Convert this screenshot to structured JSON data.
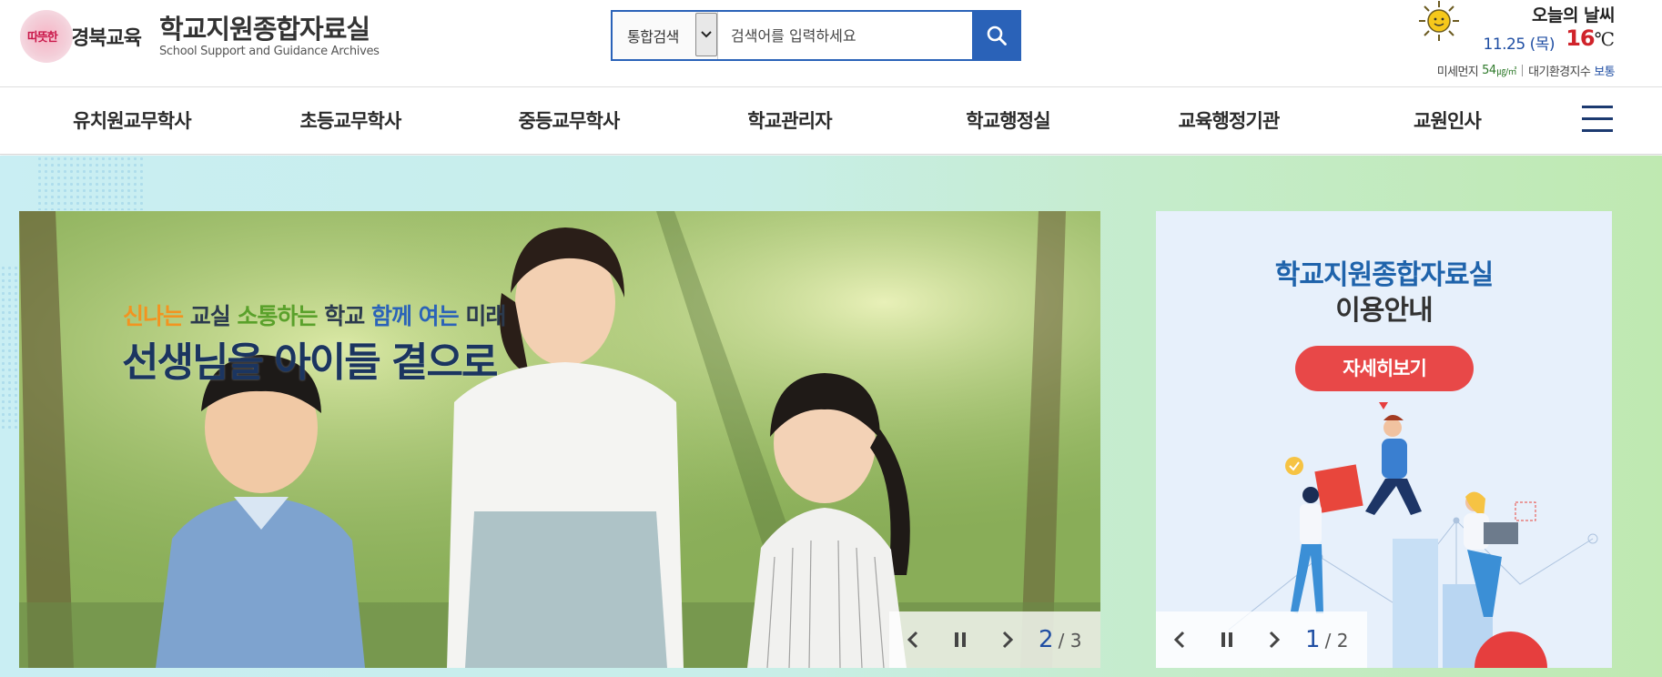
{
  "header": {
    "logo_seal_text": "따뜻한",
    "logo_brand": "경북교육",
    "site_title": "학교지원종합자료실",
    "site_subtitle": "School Support and Guidance Archives"
  },
  "search": {
    "scope_label": "통합검색",
    "placeholder": "검색어를 입력하세요"
  },
  "weather": {
    "title": "오늘의 날씨",
    "date": "11.25 (목)",
    "temperature": "16",
    "temperature_unit": "℃",
    "fine_dust_label": "미세먼지",
    "fine_dust_value": "54",
    "fine_dust_unit": "㎍/㎥",
    "air_index_label": "대기환경지수",
    "air_index_value": "보통"
  },
  "nav": {
    "items": [
      "유치원교무학사",
      "초등교무학사",
      "중등교무학사",
      "학교관리자",
      "학교행정실",
      "교육행정기관",
      "교원인사"
    ]
  },
  "banner": {
    "slogan": {
      "w1": "신나는",
      "w2": "교실",
      "w3": "소통하는",
      "w4": "학교",
      "w5": "함께 여는",
      "w6": "미래"
    },
    "headline": "선생님을 아이들 곁으로",
    "current": "2",
    "total": "/ 3"
  },
  "info_card": {
    "title": "학교지원종합자료실",
    "subtitle": "이용안내",
    "button_label": "자세히보기",
    "current": "1",
    "total": "/ 2"
  },
  "colors": {
    "primary_blue": "#2a62b8",
    "nav_text": "#2b2b2b",
    "temp_red": "#d0232a",
    "info_button": "#e84848",
    "hero_bg_left": "#c9eef3",
    "hero_bg_right": "#bfe9b1"
  },
  "icons": {
    "search_button": "search-icon",
    "weather": "sun-icon",
    "menu": "hamburger-menu-icon",
    "prev": "chevron-left-icon",
    "pause": "pause-icon",
    "next": "chevron-right-icon"
  }
}
